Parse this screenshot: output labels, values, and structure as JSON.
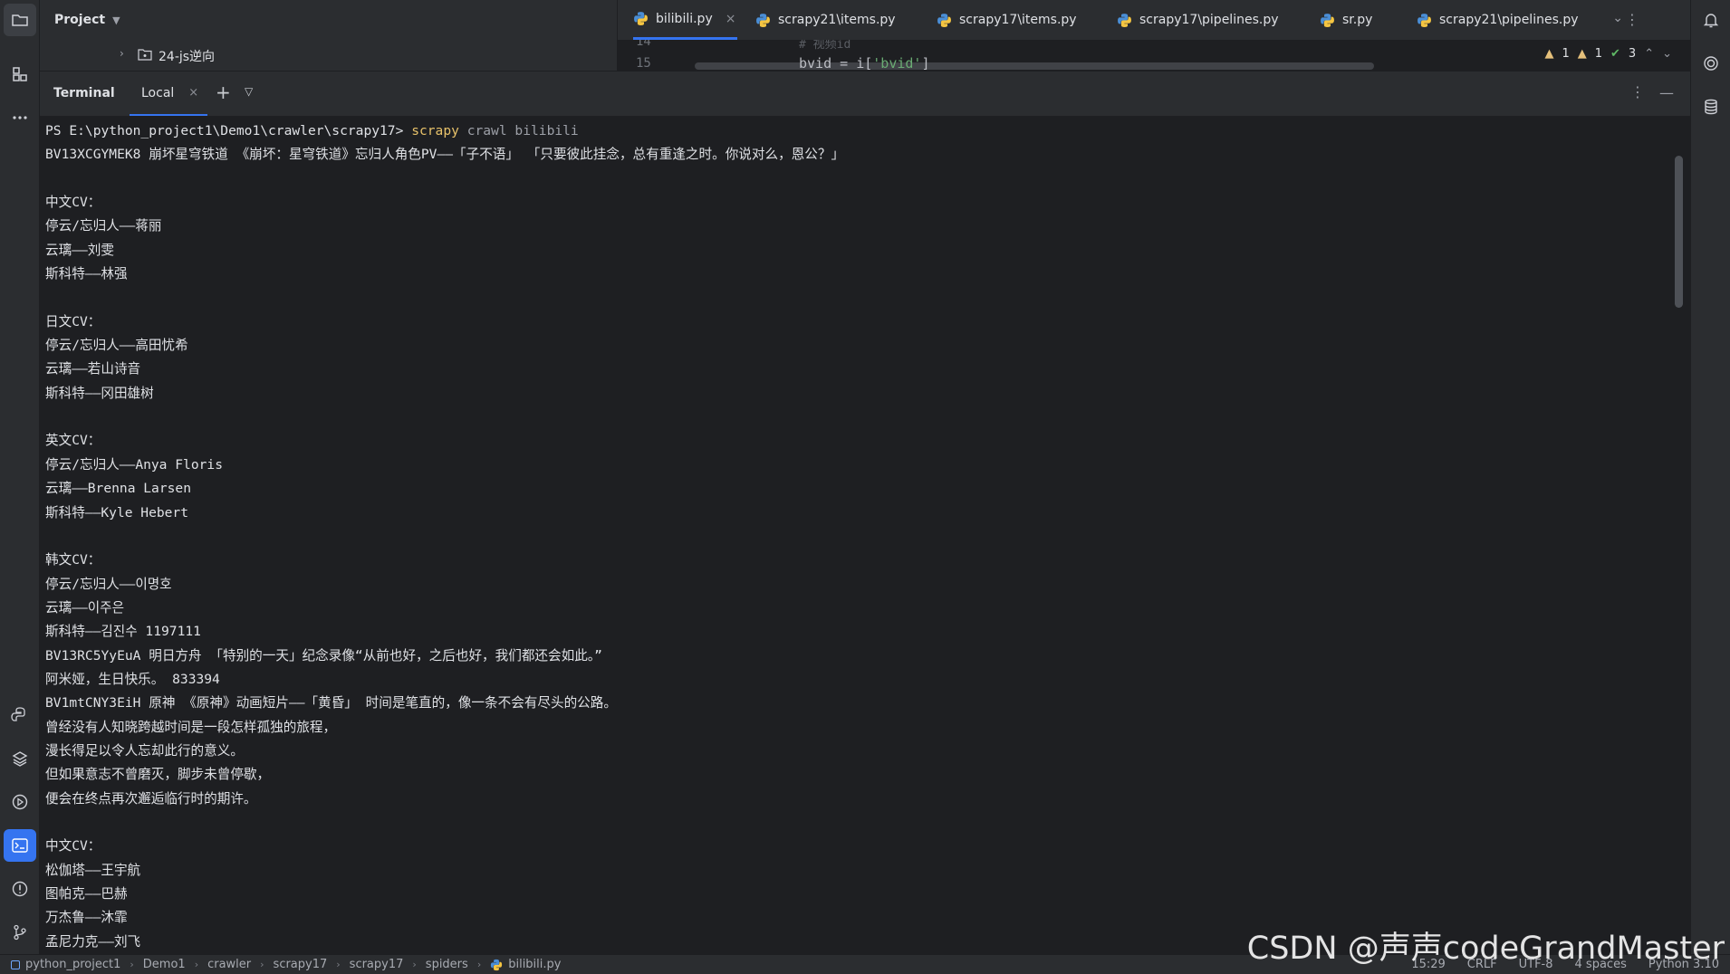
{
  "project": {
    "title": "Project",
    "tree_item": "24-js逆向"
  },
  "editor": {
    "tabs": [
      {
        "label": "bilibili.py",
        "active": true
      },
      {
        "label": "scrapy21\\items.py"
      },
      {
        "label": "scrapy17\\items.py"
      },
      {
        "label": "scrapy17\\pipelines.py"
      },
      {
        "label": "sr.py"
      },
      {
        "label": "scrapy21\\pipelines.py"
      }
    ],
    "line_prev_number": "14",
    "line_prev_code": "# 视频id",
    "line_number": "15",
    "code_prefix": "bvid = i[",
    "code_string": "'bvid'",
    "code_suffix": "]",
    "inspections": {
      "warnings": "1",
      "weak_warnings": "1",
      "ok": "3"
    }
  },
  "terminal": {
    "title": "Terminal",
    "tab_label": "Local",
    "prompt": "PS E:\\python_project1\\Demo1\\crawler\\scrapy17>",
    "command": "scrapy",
    "args": "crawl bilibili",
    "lines": [
      "BV13XCGYMEK8 崩坏星穹铁道 《崩坏：星穹铁道》忘归人角色PV——「子不语」 「只要彼此挂念，总有重逢之时。你说对么，恩公？」",
      "",
      "中文CV：",
      "停云/忘归人——蒋丽",
      "云璃——刘雯",
      "斯科特——林强",
      "",
      "日文CV：",
      "停云/忘归人——高田忧希",
      "云璃——若山诗音",
      "斯科特——冈田雄树",
      "",
      "英文CV：",
      "停云/忘归人——Anya Floris",
      "云璃——Brenna Larsen",
      "斯科特——Kyle Hebert",
      "",
      "韩文CV：",
      "停云/忘归人——이명호",
      "云璃——이주은",
      "斯科特——김진수 1197111",
      "BV13RC5YyEuA 明日方舟 「特别的一天」纪念录像“从前也好，之后也好，我们都还会如此。”",
      "阿米娅，生日快乐。 833394",
      "BV1mtCNY3EiH 原神 《原神》动画短片——「黄昏」 时间是笔直的，像一条不会有尽头的公路。",
      "曾经没有人知晓跨越时间是一段怎样孤独的旅程，",
      "漫长得足以令人忘却此行的意义。",
      "但如果意志不曾磨灭，脚步未曾停歇，",
      "便会在终点再次邂逅临行时的期许。",
      "",
      "中文CV：",
      "松伽塔——王宇航",
      "图帕克——巴赫",
      "万杰鲁——沐霏",
      "孟尼力克——刘飞"
    ]
  },
  "status": {
    "breadcrumbs": [
      "python_project1",
      "Demo1",
      "crawler",
      "scrapy17",
      "scrapy17",
      "spiders",
      "bilibili.py"
    ],
    "position": "15:29",
    "line_sep": "CRLF",
    "encoding": "UTF-8",
    "indent": "4 spaces",
    "interpreter": "Python 3.10"
  },
  "watermark": "CSDN @声声codeGrandMaster",
  "colors": {
    "accent": "#3574f0",
    "command": "#e8c26a",
    "string": "#6aab73",
    "background": "#1e1f22",
    "panel": "#2b2d30"
  },
  "icons": {
    "left": [
      "folder-icon",
      "structure-icon",
      "more-icon",
      "python-console-icon",
      "layers-icon",
      "run-icon",
      "terminal-icon",
      "problems-icon",
      "git-icon"
    ],
    "right": [
      "notifications-icon",
      "ai-assistant-icon",
      "database-icon"
    ]
  }
}
